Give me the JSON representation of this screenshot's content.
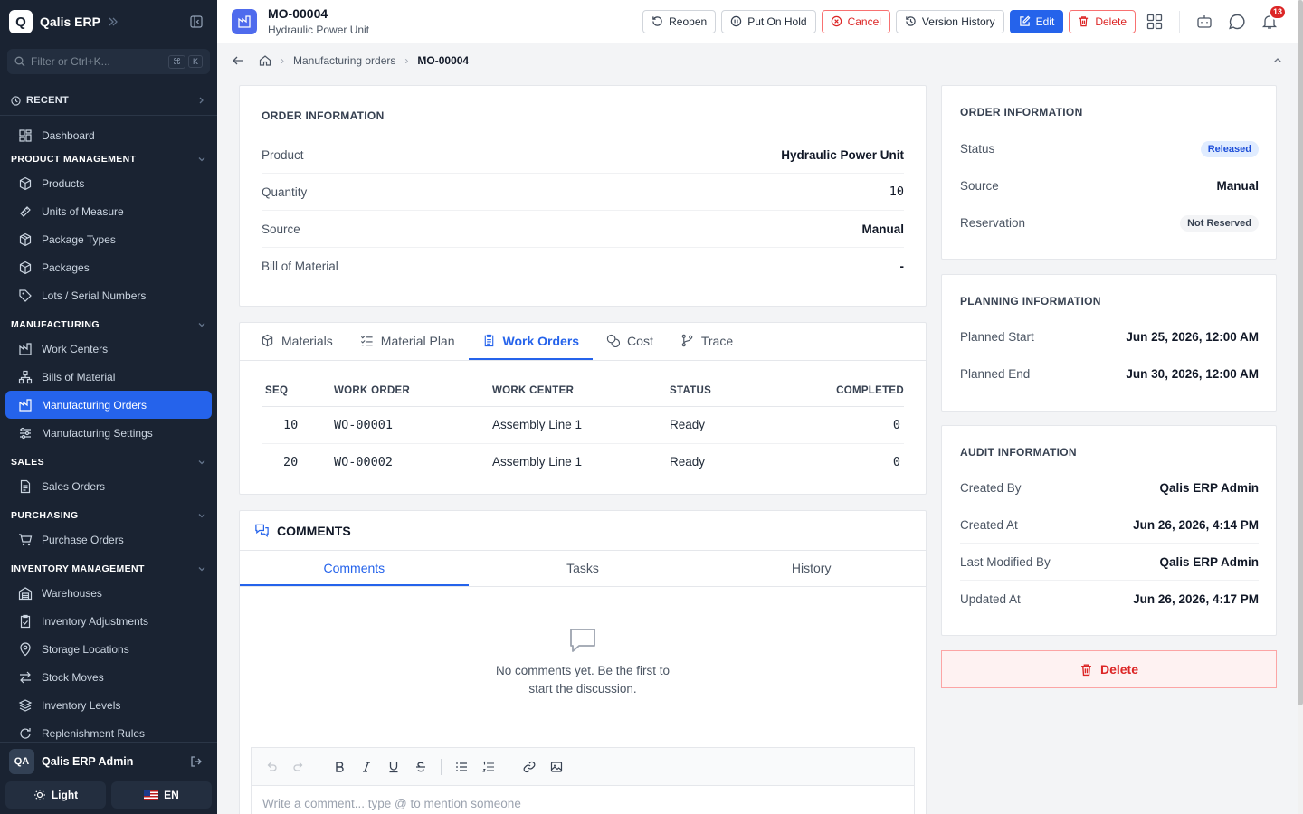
{
  "app": {
    "name": "Qalis ERP",
    "logo_letter": "Q"
  },
  "sidebar": {
    "filter_placeholder": "Filter or Ctrl+K...",
    "kbd": [
      "⌘",
      "K"
    ],
    "recent_label": "RECENT",
    "dashboard": "Dashboard",
    "sections": {
      "product_management": {
        "title": "PRODUCT MANAGEMENT",
        "items": [
          "Products",
          "Units of Measure",
          "Package Types",
          "Packages",
          "Lots / Serial Numbers"
        ]
      },
      "manufacturing": {
        "title": "MANUFACTURING",
        "items": [
          "Work Centers",
          "Bills of Material",
          "Manufacturing Orders",
          "Manufacturing Settings"
        ]
      },
      "sales": {
        "title": "SALES",
        "items": [
          "Sales Orders"
        ]
      },
      "purchasing": {
        "title": "PURCHASING",
        "items": [
          "Purchase Orders"
        ]
      },
      "inventory": {
        "title": "INVENTORY MANAGEMENT",
        "items": [
          "Warehouses",
          "Inventory Adjustments",
          "Storage Locations",
          "Stock Moves",
          "Inventory Levels",
          "Replenishment Rules"
        ]
      }
    },
    "user": {
      "initials": "QA",
      "name": "Qalis ERP Admin"
    },
    "theme_label": "Light",
    "lang_label": "EN"
  },
  "header": {
    "title": "MO-00004",
    "subtitle": "Hydraulic Power Unit",
    "actions": {
      "reopen": "Reopen",
      "hold": "Put On Hold",
      "cancel": "Cancel",
      "history": "Version History",
      "edit": "Edit",
      "delete": "Delete"
    },
    "notification_count": "13"
  },
  "breadcrumb": {
    "parent": "Manufacturing orders",
    "current": "MO-00004"
  },
  "order_info": {
    "title": "ORDER INFORMATION",
    "rows": [
      {
        "k": "Product",
        "v": "Hydraulic Power Unit"
      },
      {
        "k": "Quantity",
        "v": "10"
      },
      {
        "k": "Source",
        "v": "Manual"
      },
      {
        "k": "Bill of Material",
        "v": "-"
      }
    ]
  },
  "tabs": {
    "materials": "Materials",
    "material_plan": "Material Plan",
    "work_orders": "Work Orders",
    "cost": "Cost",
    "trace": "Trace"
  },
  "work_orders": {
    "headers": {
      "seq": "SEQ",
      "wo": "WORK ORDER",
      "wc": "WORK CENTER",
      "status": "STATUS",
      "completed": "COMPLETED"
    },
    "rows": [
      {
        "seq": "10",
        "wo": "WO-00001",
        "wc": "Assembly Line 1",
        "status": "Ready",
        "completed": "0"
      },
      {
        "seq": "20",
        "wo": "WO-00002",
        "wc": "Assembly Line 1",
        "status": "Ready",
        "completed": "0"
      }
    ]
  },
  "comments": {
    "title": "COMMENTS",
    "tabs": {
      "comments": "Comments",
      "tasks": "Tasks",
      "history": "History"
    },
    "empty_line1": "No comments yet. Be the first to",
    "empty_line2": "start the discussion.",
    "placeholder": "Write a comment... type @ to mention someone"
  },
  "side_order_info": {
    "title": "ORDER INFORMATION",
    "status_label": "Status",
    "status_value": "Released",
    "source_label": "Source",
    "source_value": "Manual",
    "reservation_label": "Reservation",
    "reservation_value": "Not Reserved"
  },
  "planning": {
    "title": "PLANNING INFORMATION",
    "rows": [
      {
        "k": "Planned Start",
        "v": "Jun 25, 2026, 12:00 AM"
      },
      {
        "k": "Planned End",
        "v": "Jun 30, 2026, 12:00 AM"
      }
    ]
  },
  "audit": {
    "title": "AUDIT INFORMATION",
    "rows": [
      {
        "k": "Created By",
        "v": "Qalis ERP Admin"
      },
      {
        "k": "Created At",
        "v": "Jun 26, 2026, 4:14 PM"
      },
      {
        "k": "Last Modified By",
        "v": "Qalis ERP Admin"
      },
      {
        "k": "Updated At",
        "v": "Jun 26, 2026, 4:17 PM"
      }
    ]
  },
  "delete_label": "Delete",
  "colors": {
    "primary": "#2563eb",
    "danger": "#dc2626",
    "sidebar_bg": "#1a2332"
  }
}
